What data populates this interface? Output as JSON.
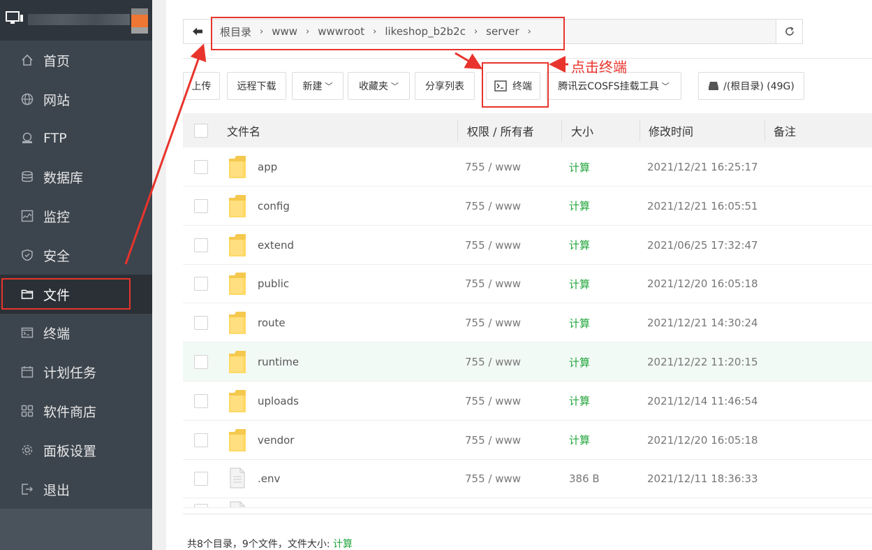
{
  "sidebar": {
    "items": [
      {
        "label": "首页",
        "icon": "home-icon"
      },
      {
        "label": "网站",
        "icon": "globe-icon"
      },
      {
        "label": "FTP",
        "icon": "ftp-icon"
      },
      {
        "label": "数据库",
        "icon": "database-icon"
      },
      {
        "label": "监控",
        "icon": "monitor-chart-icon"
      },
      {
        "label": "安全",
        "icon": "shield-icon"
      },
      {
        "label": "文件",
        "icon": "folder-icon",
        "active": true
      },
      {
        "label": "终端",
        "icon": "terminal-icon"
      },
      {
        "label": "计划任务",
        "icon": "calendar-icon"
      },
      {
        "label": "软件商店",
        "icon": "apps-grid-icon"
      },
      {
        "label": "面板设置",
        "icon": "gear-icon"
      },
      {
        "label": "退出",
        "icon": "logout-icon"
      }
    ]
  },
  "path": {
    "crumbs": [
      "根目录",
      "www",
      "wwwroot",
      "likeshop_b2b2c",
      "server"
    ]
  },
  "toolbar": {
    "upload": "上传",
    "remote_download": "远程下载",
    "new": "新建",
    "favorites": "收藏夹",
    "share_list": "分享列表",
    "terminal": "终端",
    "cosfs": "腾讯云COSFS挂载工具",
    "disk": "/(根目录) (49G)"
  },
  "table": {
    "headers": {
      "name": "文件名",
      "perm": "权限 / 所有者",
      "size": "大小",
      "mtime": "修改时间",
      "note": "备注"
    },
    "rows": [
      {
        "name": "app",
        "type": "folder",
        "perm": "755 / www",
        "size": "计算",
        "mtime": "2021/12/21 16:25:17"
      },
      {
        "name": "config",
        "type": "folder",
        "perm": "755 / www",
        "size": "计算",
        "mtime": "2021/12/21 16:05:51"
      },
      {
        "name": "extend",
        "type": "folder",
        "perm": "755 / www",
        "size": "计算",
        "mtime": "2021/06/25 17:32:47"
      },
      {
        "name": "public",
        "type": "folder",
        "perm": "755 / www",
        "size": "计算",
        "mtime": "2021/12/20 16:05:18"
      },
      {
        "name": "route",
        "type": "folder",
        "perm": "755 / www",
        "size": "计算",
        "mtime": "2021/12/21 14:30:24"
      },
      {
        "name": "runtime",
        "type": "folder",
        "perm": "755 / www",
        "size": "计算",
        "mtime": "2021/12/22 11:20:15"
      },
      {
        "name": "uploads",
        "type": "folder",
        "perm": "755 / www",
        "size": "计算",
        "mtime": "2021/12/14 11:46:54"
      },
      {
        "name": "vendor",
        "type": "folder",
        "perm": "755 / www",
        "size": "计算",
        "mtime": "2021/12/20 16:05:18"
      },
      {
        "name": ".env",
        "type": "file",
        "perm": "755 / www",
        "size": "386 B",
        "mtime": "2021/12/11 18:36:33"
      }
    ]
  },
  "footer": {
    "summary": "共8个目录，9个文件，文件大小: ",
    "calc": "计算"
  },
  "annotation": {
    "label": "点击终端",
    "color": "#e8342c"
  },
  "colors": {
    "sidebar_bg": "#3c444d",
    "accent_green": "#20a53a",
    "annotation_red": "#e8342c"
  }
}
